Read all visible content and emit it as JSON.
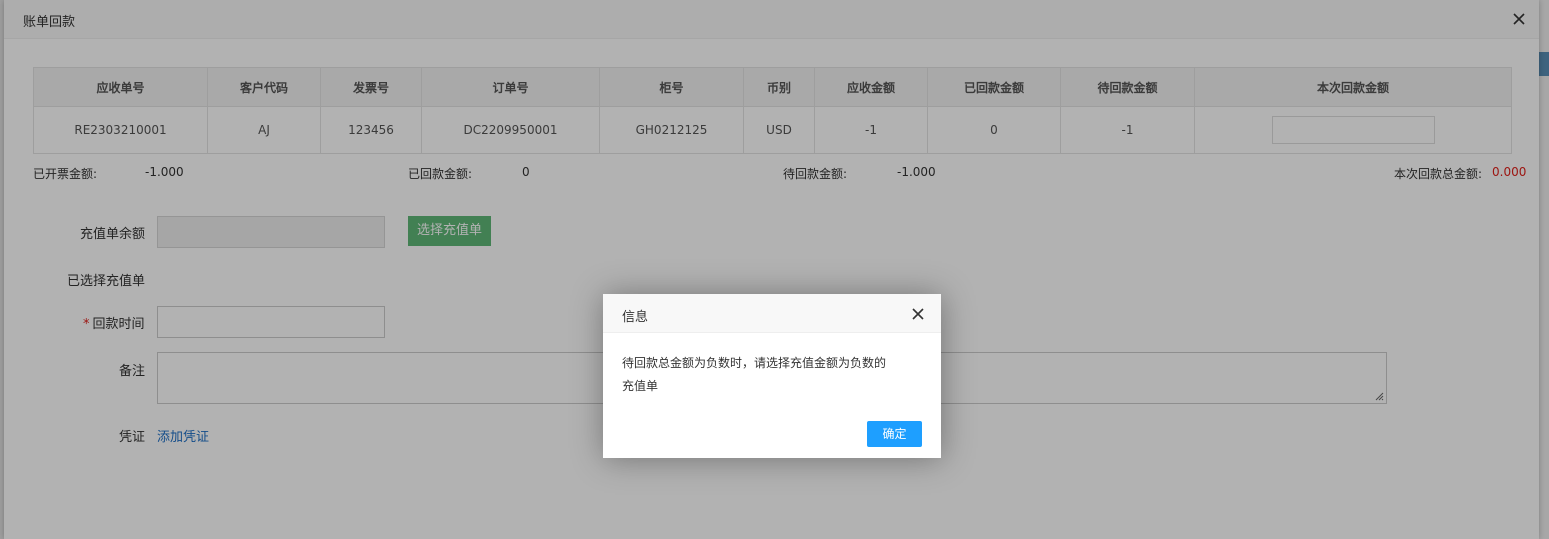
{
  "window": {
    "title": "账单回款"
  },
  "table": {
    "headers": [
      "应收单号",
      "客户代码",
      "发票号",
      "订单号",
      "柜号",
      "币别",
      "应收金额",
      "已回款金额",
      "待回款金额",
      "本次回款金额"
    ],
    "row": [
      "RE2303210001",
      "AJ",
      "123456",
      "DC2209950001",
      "GH0212125",
      "USD",
      "-1",
      "0",
      "-1"
    ]
  },
  "summary": {
    "invoiced_label": "已开票金额:",
    "invoiced_value": "-1.000",
    "received_label": "已回款金额:",
    "received_value": "0",
    "pending_label": "待回款金额:",
    "pending_value": "-1.000",
    "current_total_label": "本次回款总金额:",
    "current_total_value": "0.000"
  },
  "form": {
    "recharge_balance_label": "充值单余额",
    "select_recharge_button": "选择充值单",
    "selected_recharge_label": "已选择充值单",
    "required_mark": "*",
    "payment_time_label": "回款时间",
    "remark_label": "备注",
    "voucher_label": "凭证",
    "add_voucher_link": "添加凭证"
  },
  "dialog": {
    "title": "信息",
    "message_line1": "待回款总金额为负数时，请选择充值金额为负数的",
    "message_line2": "充值单",
    "ok_button": "确定"
  },
  "colors": {
    "accent_blue": "#1e9fff",
    "green_button": "#5fb878",
    "required_red": "#e0201b"
  }
}
